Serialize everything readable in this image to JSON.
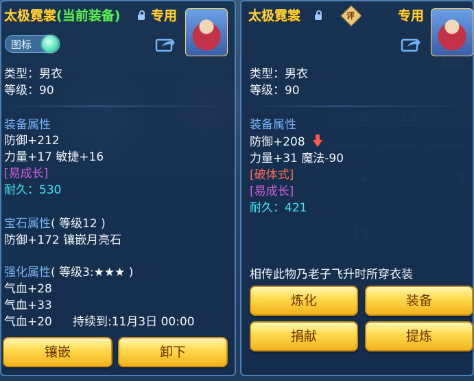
{
  "left": {
    "title_main": "太极霓裳",
    "title_tag": "(当前装备)",
    "exclusive": "专用",
    "toggle_label": "图标",
    "type_line": "类型：男衣",
    "level_line": "等级：90",
    "attr_header": "装备属性",
    "defense": "防御+212",
    "str_agi": "力量+17 敏捷+16",
    "grow_tag": "[易成长]",
    "durability_label": "耐久：",
    "durability_value": "530",
    "gem_header": "宝石属性",
    "gem_level": "( 等级12 )",
    "gem_detail": "防御+172 镶嵌月亮石",
    "enhance_header": "强化属性",
    "enhance_level": "( 等级3:★★★ )",
    "hp1": "气血+28",
    "hp2": "气血+33",
    "hp3": "气血+20",
    "duration": "持续到:11月3日 00:00",
    "btn_inlay": "镶嵌",
    "btn_unequip": "卸下"
  },
  "right": {
    "title_main": "太极霓裳",
    "rating_badge": "评",
    "exclusive": "专用",
    "type_line": "类型：男衣",
    "level_line": "等级：90",
    "attr_header": "装备属性",
    "defense": "防御+208",
    "str_magic": "力量+31 魔法-90",
    "break_tag": "[破体式]",
    "grow_tag": "[易成长]",
    "durability_label": "耐久：",
    "durability_value": "421",
    "lore": "相传此物乃老子飞升时所穿衣装",
    "btn_refine": "炼化",
    "btn_equip": "装备",
    "btn_donate": "捐献",
    "btn_extract": "提炼"
  },
  "background_numbers": [
    "155",
    "8",
    "13",
    "4",
    "3",
    "13"
  ],
  "colors": {
    "title": "#ffd43a",
    "current_tag": "#5cf25c",
    "section_header": "#79b4f6",
    "grow_tag": "#d85ee0",
    "break_tag": "#ff6a5a",
    "durability": "#3fe8f2",
    "button": "#ffd84a"
  }
}
